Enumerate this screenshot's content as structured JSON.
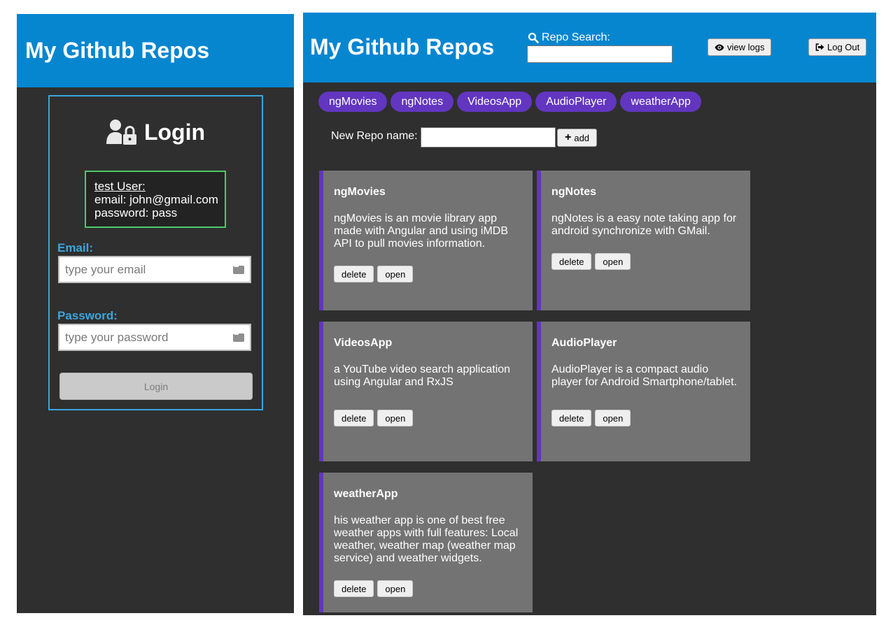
{
  "app": {
    "title": "My Github Repos"
  },
  "login": {
    "title": "Login",
    "test_user": {
      "heading": "test User:",
      "email_line": "email: john@gmail.com",
      "password_line": "password: pass"
    },
    "email_label": "Email:",
    "email_placeholder": "type your email",
    "password_label": "Password:",
    "password_placeholder": "type your password",
    "button_label": "Login"
  },
  "header": {
    "search_label": "Repo Search:",
    "search_value": "",
    "view_logs_label": "view logs",
    "logout_label": "Log Out"
  },
  "tabs": [
    "ngMovies",
    "ngNotes",
    "VideosApp",
    "AudioPlayer",
    "weatherApp"
  ],
  "new_repo": {
    "label": "New Repo name:",
    "value": "",
    "add_label": "add"
  },
  "repos": [
    {
      "name": "ngMovies",
      "description": "ngMovies is an movie library app made with Angular and using iMDB API to pull movies information.",
      "delete_label": "delete",
      "open_label": "open"
    },
    {
      "name": "ngNotes",
      "description": "ngNotes is a easy note taking app for android synchronize with GMail.",
      "delete_label": "delete",
      "open_label": "open"
    },
    {
      "name": "VideosApp",
      "description": "a YouTube video search application using Angular and RxJS",
      "delete_label": "delete",
      "open_label": "open"
    },
    {
      "name": "AudioPlayer",
      "description": "AudioPlayer is a compact audio player for Android Smartphone/tablet.",
      "delete_label": "delete",
      "open_label": "open"
    },
    {
      "name": "weatherApp",
      "description": "his weather app is one of best free weather apps with full features: Local weather, weather map (weather map service) and weather widgets.",
      "delete_label": "delete",
      "open_label": "open"
    }
  ],
  "colors": {
    "header_blue": "#0786d0",
    "panel_dark": "#2f2f2f",
    "accent_purple": "#6236c0",
    "card_gray": "#737373",
    "login_border": "#3aa6de",
    "test_user_border": "#4cca6a"
  }
}
